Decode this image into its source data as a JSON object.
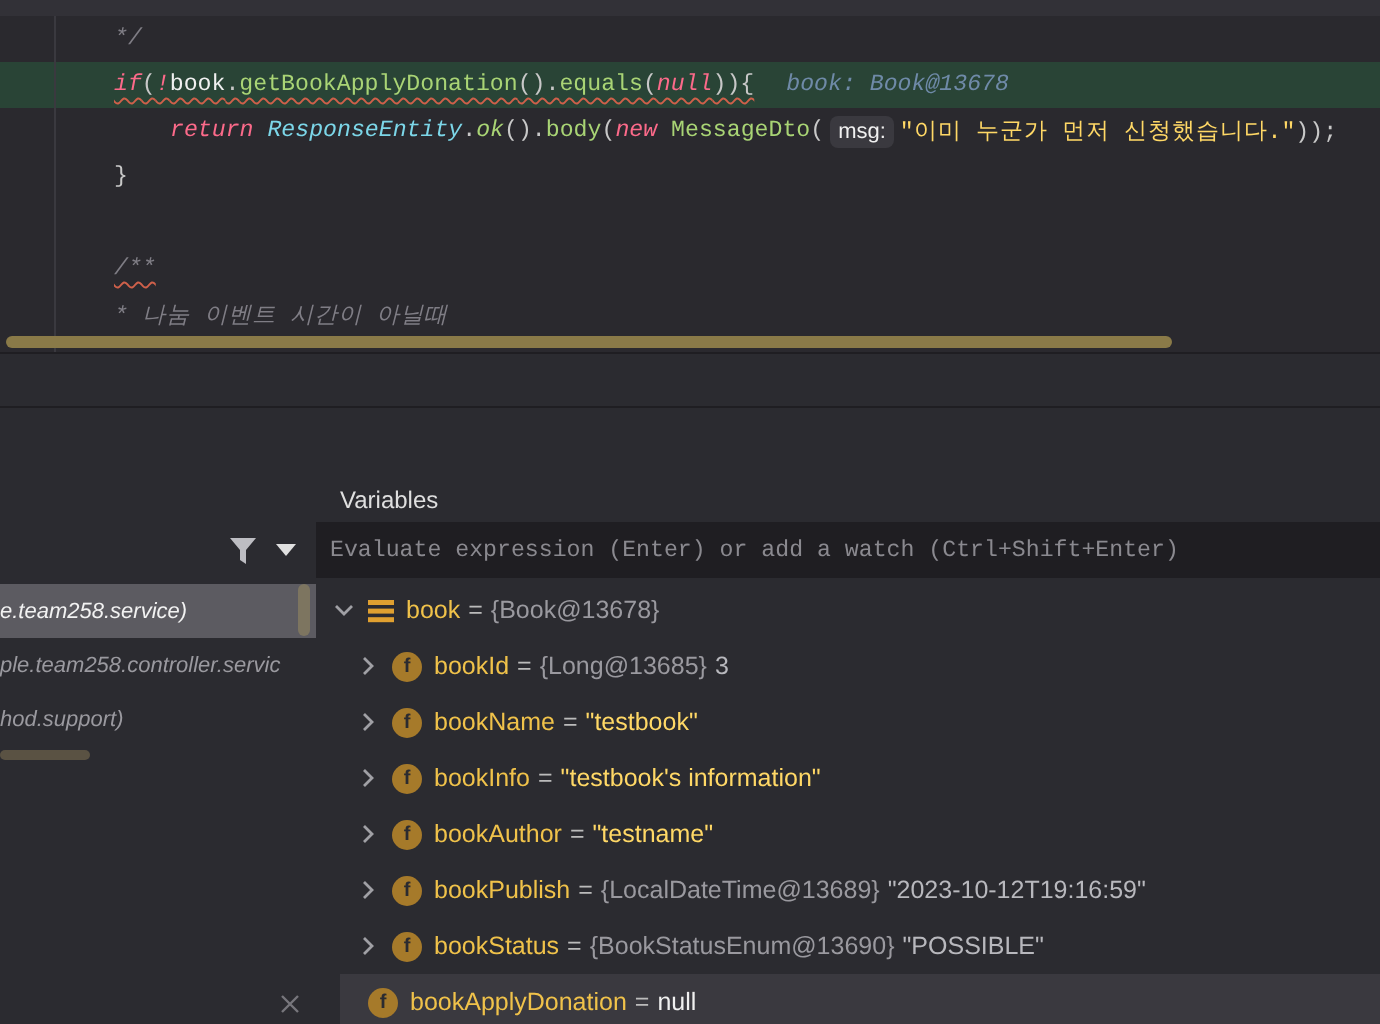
{
  "editor": {
    "lines": [
      {
        "highlighted": false,
        "warning": false,
        "segments": [
          {
            "kind": "code",
            "tokens": [
              {
                "t": "*/",
                "kind": "comment"
              }
            ]
          }
        ]
      },
      {
        "highlighted": true,
        "warning": true,
        "segments": [
          {
            "kind": "code",
            "tokens": [
              {
                "t": "if",
                "kind": "keyword"
              },
              {
                "t": "(",
                "kind": "punct"
              },
              {
                "t": "!",
                "kind": "keyword"
              },
              {
                "t": "book",
                "kind": "plain"
              },
              {
                "t": ".",
                "kind": "punct"
              },
              {
                "t": "getBookApplyDonation",
                "kind": "method"
              },
              {
                "t": "().",
                "kind": "punct"
              },
              {
                "t": "equals",
                "kind": "method"
              },
              {
                "t": "(",
                "kind": "punct"
              },
              {
                "t": "null",
                "kind": "keyword"
              },
              {
                "t": ")){",
                "kind": "punct"
              }
            ]
          },
          {
            "kind": "inline_value",
            "text": "book: Book@13678"
          }
        ],
        "children": [
          {
            "highlighted": false,
            "warning": false,
            "segments": [
              {
                "kind": "code",
                "tokens": [
                  {
                    "t": "return ",
                    "kind": "keyword"
                  },
                  {
                    "t": "ResponseEntity",
                    "kind": "class"
                  },
                  {
                    "t": ".",
                    "kind": "punct"
                  },
                  {
                    "t": "ok",
                    "kind": "static"
                  },
                  {
                    "t": "().",
                    "kind": "punct"
                  },
                  {
                    "t": "body",
                    "kind": "method"
                  },
                  {
                    "t": "(",
                    "kind": "punct"
                  },
                  {
                    "t": "new ",
                    "kind": "keyword"
                  },
                  {
                    "t": "MessageDto",
                    "kind": "method"
                  },
                  {
                    "t": "(",
                    "kind": "punct"
                  }
                ]
              },
              {
                "kind": "param_hint",
                "text": "msg:"
              },
              {
                "kind": "code",
                "tokens": [
                  {
                    "t": "\"이미 누군가 먼저 신청했습니다.\"",
                    "kind": "string"
                  },
                  {
                    "t": "));",
                    "kind": "punct"
                  }
                ]
              }
            ]
          }
        ]
      },
      {
        "highlighted": false,
        "warning": false,
        "segments": [
          {
            "kind": "code",
            "tokens": [
              {
                "t": "}",
                "kind": "punct"
              }
            ]
          }
        ]
      },
      {
        "highlighted": false,
        "warning": true,
        "gap_before": true,
        "segments": [
          {
            "kind": "code",
            "tokens": [
              {
                "t": "/**",
                "kind": "comment"
              }
            ]
          }
        ]
      },
      {
        "highlighted": false,
        "warning": false,
        "segments": [
          {
            "kind": "code",
            "tokens": [
              {
                "t": "* 나눔 이벤트 시간이 아닐때",
                "kind": "comment"
              }
            ]
          }
        ]
      }
    ]
  },
  "debugger": {
    "title": "Variables",
    "frames": [
      {
        "label": "e.team258.service)",
        "selected": true
      },
      {
        "label": "ple.team258.controller.servic",
        "selected": false
      },
      {
        "label": "hod.support)",
        "selected": false
      }
    ],
    "evaluate": {
      "placeholder": "Evaluate expression (Enter) or add a watch (Ctrl+Shift+Enter)"
    },
    "variables": [
      {
        "kind": "object",
        "name": "book",
        "op": "=",
        "ref": "{Book@13678}",
        "expanded": true,
        "selected": false,
        "children": [
          {
            "kind": "field",
            "badge": "f",
            "name": "bookId",
            "op": "=",
            "ref": "{Long@13685}",
            "value": {
              "text": "3",
              "kind": "plain"
            },
            "expanded": false,
            "selected": false
          },
          {
            "kind": "field",
            "badge": "f",
            "name": "bookName",
            "op": "=",
            "value": {
              "text": "\"testbook\"",
              "kind": "string"
            },
            "expanded": false,
            "selected": false
          },
          {
            "kind": "field",
            "badge": "f",
            "name": "bookInfo",
            "op": "=",
            "value": {
              "text": "\"testbook's information\"",
              "kind": "string"
            },
            "expanded": false,
            "selected": false
          },
          {
            "kind": "field",
            "badge": "f",
            "name": "bookAuthor",
            "op": "=",
            "value": {
              "text": "\"testname\"",
              "kind": "string"
            },
            "expanded": false,
            "selected": false
          },
          {
            "kind": "field",
            "badge": "f",
            "name": "bookPublish",
            "op": "=",
            "ref": "{LocalDateTime@13689}",
            "value": {
              "text": "\"2023-10-12T19:16:59\"",
              "kind": "plain"
            },
            "expanded": false,
            "selected": false
          },
          {
            "kind": "field",
            "badge": "f",
            "name": "bookStatus",
            "op": "=",
            "ref": "{BookStatusEnum@13690}",
            "value": {
              "text": "\"POSSIBLE\"",
              "kind": "plain"
            },
            "expanded": false,
            "selected": false
          },
          {
            "kind": "field",
            "badge": "f",
            "name": "bookApplyDonation",
            "op": "=",
            "value": {
              "text": "null",
              "kind": "null"
            },
            "selected": true
          }
        ]
      }
    ]
  }
}
